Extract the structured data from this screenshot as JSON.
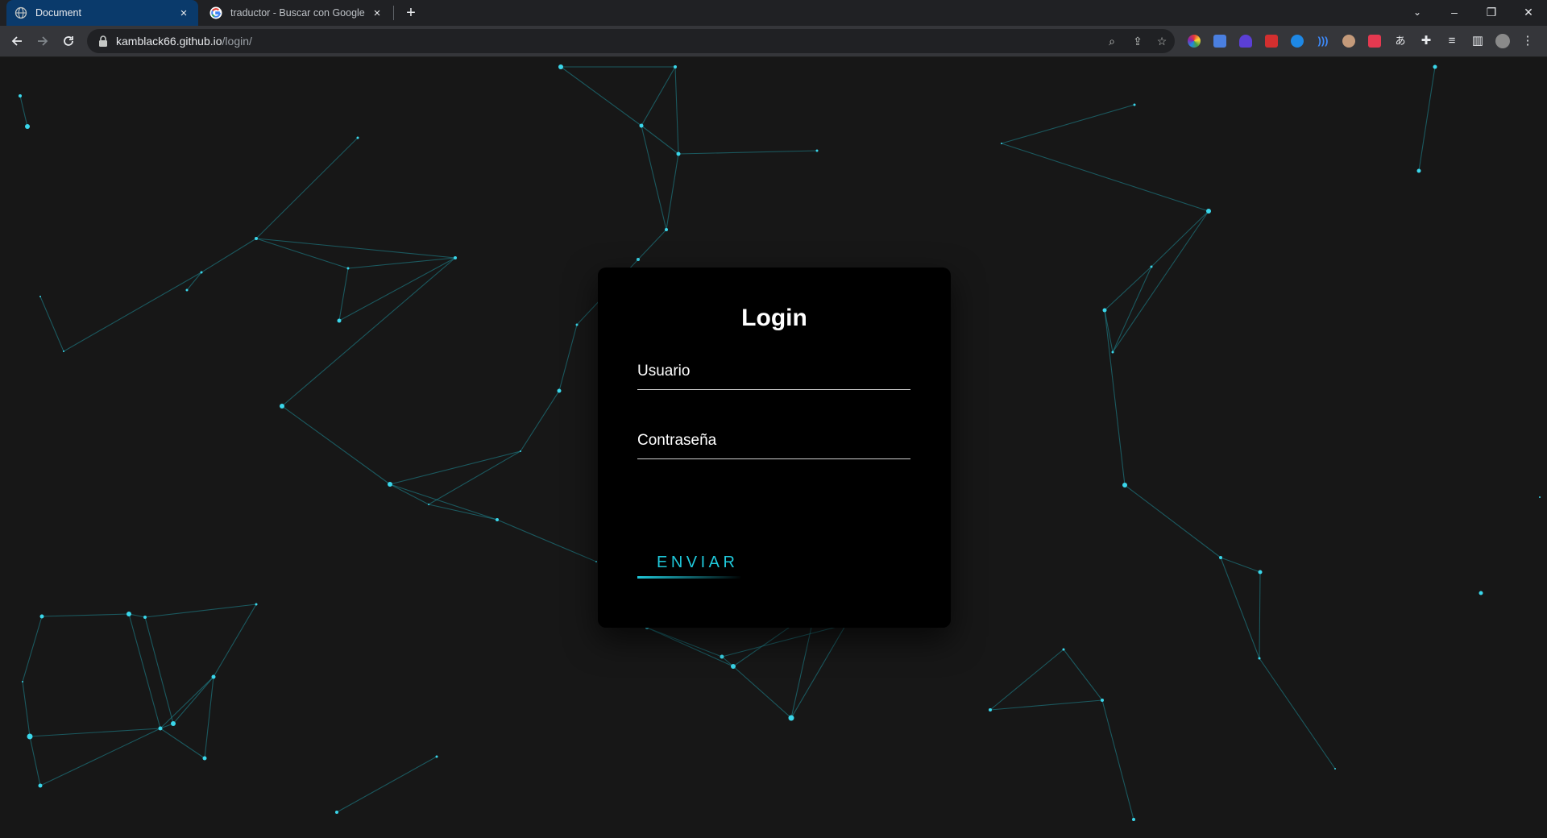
{
  "browser": {
    "tabs": [
      {
        "title": "Document",
        "favicon": "globe-icon",
        "active": true
      },
      {
        "title": "traductor - Buscar con Google",
        "favicon": "google-icon",
        "active": false
      }
    ],
    "new_tab": "+",
    "address": {
      "host": "kamblack66.github.io",
      "path": "/login/"
    },
    "window_controls": {
      "minimize": "–",
      "restore": "❐",
      "close": "✕"
    },
    "accent_color": "#0a3a6b"
  },
  "login": {
    "title": "Login",
    "username_placeholder": "Usuario",
    "password_placeholder": "Contraseña",
    "submit_label": "ENVIAR",
    "accent_color": "#1fc8da"
  },
  "background": {
    "color": "#171717",
    "particle_color": "#3ad6ea",
    "link_color": "#1f8f9a"
  }
}
